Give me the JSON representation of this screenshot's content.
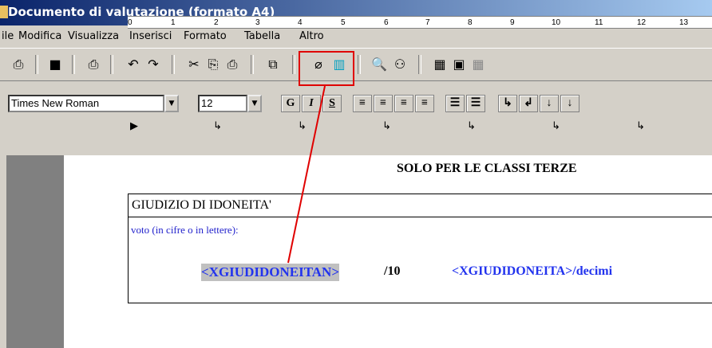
{
  "window": {
    "title": "Documento di valutazione (formato A4)"
  },
  "menu": [
    "ile",
    "Modifica",
    "Visualizza",
    "Inserisci",
    "Formato",
    "Tabella",
    "Altro"
  ],
  "format": {
    "font_name": "Times New Roman",
    "font_size": "12",
    "bold_label": "G",
    "italic_label": "I",
    "underline_label": "S"
  },
  "ruler": {
    "numbers": [
      "0",
      "1",
      "2",
      "3",
      "4",
      "5",
      "6",
      "7",
      "8",
      "9",
      "10",
      "11",
      "12",
      "13"
    ]
  },
  "document": {
    "heading": "SOLO PER LE CLASSI TERZE",
    "box_title": "GIUDIZIO DI IDONEITA'",
    "voto_label": "voto (in cifre o in lettere):",
    "field_number": "<XGIUDIDONEITAN>",
    "field_number_suffix": "/10",
    "field_text": "<XGIUDIDONEITA>/decimi"
  },
  "colors": {
    "highlight": "#e00000",
    "field_blue": "#2233ee",
    "field_bg": "#c0c0c0",
    "title_bar": "#0a246a"
  }
}
